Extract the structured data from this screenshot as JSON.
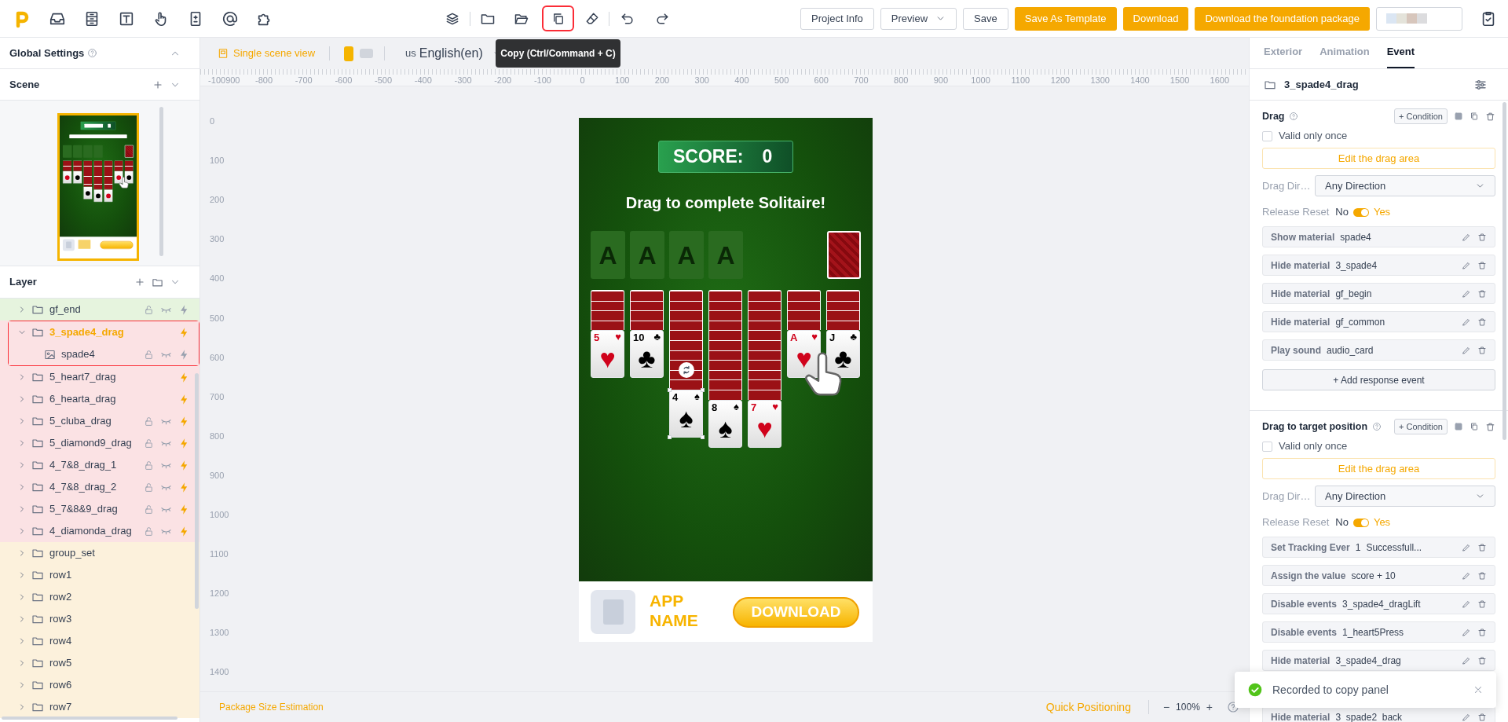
{
  "toolbar": {
    "tooltip": "Copy (Ctrl/Command + C)",
    "buttons": [
      {
        "label": "Project Info",
        "kind": "outline"
      },
      {
        "label": "Preview",
        "kind": "dropdown"
      },
      {
        "label": "Save",
        "kind": "outline"
      },
      {
        "label": "Save As Template",
        "kind": "primary"
      },
      {
        "label": "Download",
        "kind": "primary"
      },
      {
        "label": "Download the foundation package",
        "kind": "primary"
      }
    ]
  },
  "left_panel": {
    "global_settings": "Global Settings",
    "scene_title": "Scene",
    "layer_title": "Layer",
    "layers": [
      {
        "name": "gf_end",
        "kind": "folder",
        "color": "#e6f4de",
        "locks": true,
        "event_icon": true,
        "event_active": false,
        "selected": false,
        "expanded": false
      },
      {
        "name": "3_spade4_drag",
        "kind": "folder",
        "color": "#fbe2e4",
        "locks": false,
        "event_icon": true,
        "event_active": true,
        "selected": true,
        "expanded": true,
        "children": [
          {
            "name": "spade4",
            "kind": "image",
            "color": "#fbe2e4",
            "locks": true,
            "event_icon": true,
            "event_active": false,
            "selected": false
          }
        ]
      },
      {
        "name": "5_heart7_drag",
        "kind": "folder",
        "color": "#fbe2e4",
        "locks": false,
        "event_icon": true,
        "event_active": true,
        "selected": false,
        "expanded": false
      },
      {
        "name": "6_hearta_drag",
        "kind": "folder",
        "color": "#fbe2e4",
        "locks": false,
        "event_icon": true,
        "event_active": true,
        "selected": false,
        "expanded": false
      },
      {
        "name": "5_cluba_drag",
        "kind": "folder",
        "color": "#fbe2e4",
        "locks": true,
        "event_icon": true,
        "event_active": true,
        "selected": false,
        "expanded": false
      },
      {
        "name": "5_diamond9_drag",
        "kind": "folder",
        "color": "#fbe2e4",
        "locks": true,
        "event_icon": true,
        "event_active": true,
        "selected": false,
        "expanded": false
      },
      {
        "name": "4_7&8_drag_1",
        "kind": "folder",
        "color": "#fbe2e4",
        "locks": true,
        "event_icon": true,
        "event_active": true,
        "selected": false,
        "expanded": false
      },
      {
        "name": "4_7&8_drag_2",
        "kind": "folder",
        "color": "#fbe2e4",
        "locks": true,
        "event_icon": true,
        "event_active": true,
        "selected": false,
        "expanded": false
      },
      {
        "name": "5_7&8&9_drag",
        "kind": "folder",
        "color": "#fbe2e4",
        "locks": true,
        "event_icon": true,
        "event_active": true,
        "selected": false,
        "expanded": false
      },
      {
        "name": "4_diamonda_drag",
        "kind": "folder",
        "color": "#fbe2e4",
        "locks": true,
        "event_icon": true,
        "event_active": true,
        "selected": false,
        "expanded": false
      },
      {
        "name": "group_set",
        "kind": "folder",
        "color": "#fcf1dc",
        "locks": false,
        "event_icon": false,
        "selected": false,
        "expanded": false
      },
      {
        "name": "row1",
        "kind": "folder",
        "color": "#fcf1dc",
        "locks": false,
        "event_icon": false,
        "selected": false,
        "expanded": false
      },
      {
        "name": "row2",
        "kind": "folder",
        "color": "#fcf1dc",
        "locks": false,
        "event_icon": false,
        "selected": false,
        "expanded": false
      },
      {
        "name": "row3",
        "kind": "folder",
        "color": "#fcf1dc",
        "locks": false,
        "event_icon": false,
        "selected": false,
        "expanded": false
      },
      {
        "name": "row4",
        "kind": "folder",
        "color": "#fcf1dc",
        "locks": false,
        "event_icon": false,
        "selected": false,
        "expanded": false
      },
      {
        "name": "row5",
        "kind": "folder",
        "color": "#fcf1dc",
        "locks": false,
        "event_icon": false,
        "selected": false,
        "expanded": false
      },
      {
        "name": "row6",
        "kind": "folder",
        "color": "#fcf1dc",
        "locks": false,
        "event_icon": false,
        "selected": false,
        "expanded": false
      },
      {
        "name": "row7",
        "kind": "folder",
        "color": "#fcf1dc",
        "locks": false,
        "event_icon": false,
        "selected": false,
        "expanded": false
      }
    ]
  },
  "canvas_toolbar": {
    "view_mode": "Single scene view",
    "orientations": [
      {
        "kind": "portrait",
        "selected": true
      },
      {
        "kind": "landscape",
        "selected": false
      }
    ],
    "flag": "us",
    "language": "English(en)"
  },
  "ruler": {
    "x_labels": [
      "-100900",
      "-800",
      "-700",
      "-600",
      "-500",
      "-400",
      "-300",
      "-200",
      "-100",
      "0",
      "100",
      "200",
      "300",
      "400",
      "500",
      "600",
      "700",
      "800",
      "900",
      "1000",
      "1100",
      "1200",
      "1300",
      "1400",
      "1500",
      "1600"
    ],
    "y_labels": [
      "0",
      "100",
      "200",
      "300",
      "400",
      "500",
      "600",
      "700",
      "800",
      "900",
      "1000",
      "1100",
      "1200",
      "1300",
      "1400"
    ]
  },
  "scene": {
    "score_label": "SCORE:",
    "score": "0",
    "instruction": "Drag to complete Solitaire!",
    "foundations": [
      "A",
      "A",
      "A",
      "A"
    ],
    "tableau": [
      {
        "rank": "5",
        "suit": "♥",
        "pip": "♥",
        "color": "#d0021b",
        "kind": "short",
        "selected": false
      },
      {
        "rank": "10",
        "suit": "♣",
        "pip": "♣",
        "color": "#000000",
        "kind": "short",
        "selected": false
      },
      {
        "rank": "4",
        "suit": "♠",
        "pip": "♠",
        "color": "#000000",
        "kind": "medium",
        "selected": true
      },
      {
        "rank": "8",
        "suit": "♠",
        "pip": "♠",
        "color": "#000000",
        "kind": "long",
        "selected": false
      },
      {
        "rank": "7",
        "suit": "♥",
        "pip": "♥",
        "color": "#d0021b",
        "kind": "long",
        "selected": false
      },
      {
        "rank": "A",
        "suit": "♥",
        "pip": "♥",
        "color": "#d0021b",
        "kind": "short",
        "selected": false
      },
      {
        "rank": "J",
        "suit": "♣",
        "pip": "♣",
        "color": "#000000",
        "kind": "short",
        "selected": false
      }
    ],
    "app_name": "APP NAME",
    "download": "DOWNLOAD"
  },
  "bottom_bar": {
    "package_size": "Package Size Estimation",
    "quick_positioning": "Quick Positioning",
    "zoom_out": "−",
    "zoom": "100%",
    "zoom_in": "+"
  },
  "right_panel": {
    "tabs": [
      {
        "label": "Exterior",
        "selected": false
      },
      {
        "label": "Animation",
        "selected": false
      },
      {
        "label": "Event",
        "selected": true
      }
    ],
    "layer_name": "3_spade4_drag",
    "events": [
      {
        "title": "Drag",
        "condition": "+ Condition",
        "valid_once_label": "Valid only once",
        "valid_once": false,
        "edit_area": "Edit the drag area",
        "direction_label": "Drag Dir…",
        "direction": "Any Direction",
        "release_label": "Release Reset",
        "no": "No",
        "yes": "Yes",
        "release_reset": true,
        "actions": [
          {
            "action": "Show material",
            "target": "spade4"
          },
          {
            "action": "Hide material",
            "target": "3_spade4"
          },
          {
            "action": "Hide material",
            "target": "gf_begin"
          },
          {
            "action": "Hide material",
            "target": "gf_common"
          },
          {
            "action": "Play sound",
            "target": "audio_card"
          }
        ],
        "add_label": "+ Add response event"
      },
      {
        "title": "Drag to target position",
        "condition": "+ Condition",
        "valid_once_label": "Valid only once",
        "valid_once": false,
        "edit_area": "Edit the drag area",
        "direction_label": "Drag Dir…",
        "direction": "Any Direction",
        "release_label": "Release Reset",
        "no": "No",
        "yes": "Yes",
        "release_reset": true,
        "actions": [
          {
            "action": "Set Tracking Ever",
            "target": "1",
            "detail": "Successfull..."
          },
          {
            "action": "Assign the value",
            "target": "score + 10"
          },
          {
            "action": "Disable events",
            "target": "3_spade4_dragLift"
          },
          {
            "action": "Disable events",
            "target": "1_heart5Press"
          },
          {
            "action": "Hide material",
            "target": "3_spade4_drag"
          },
          {
            "action": "Hide material",
            "target": "3_spade2_back"
          }
        ]
      }
    ]
  },
  "toast": "Recorded to copy panel"
}
